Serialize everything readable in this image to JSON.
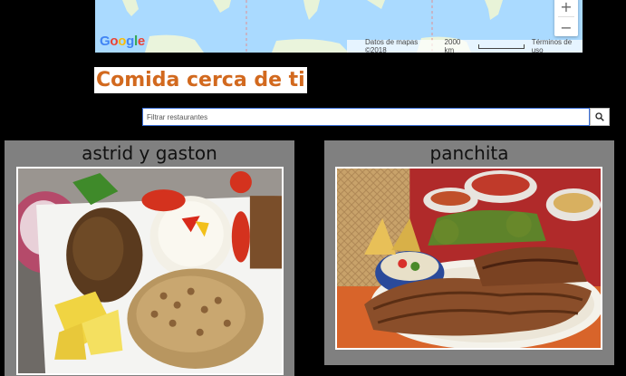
{
  "map": {
    "logo_text": "Google",
    "attribution": "Datos de mapas ©2018",
    "scale_label": "2000 km",
    "terms": "Términos de uso",
    "zoom_in": "+",
    "zoom_out": "−"
  },
  "page_title": "Comida cerca de ti",
  "search": {
    "placeholder": "Filtrar restaurantes",
    "value": "",
    "button_icon": "search-icon"
  },
  "restaurants": [
    {
      "name": "astrid y gaston",
      "photo": "peruvian-plate-photo"
    },
    {
      "name": "panchita",
      "photo": "grilled-steak-platter-photo"
    }
  ],
  "colors": {
    "title": "#d2691e",
    "card_bg": "#808080",
    "map_water": "#aadaff",
    "search_border": "#3a6fd8"
  }
}
